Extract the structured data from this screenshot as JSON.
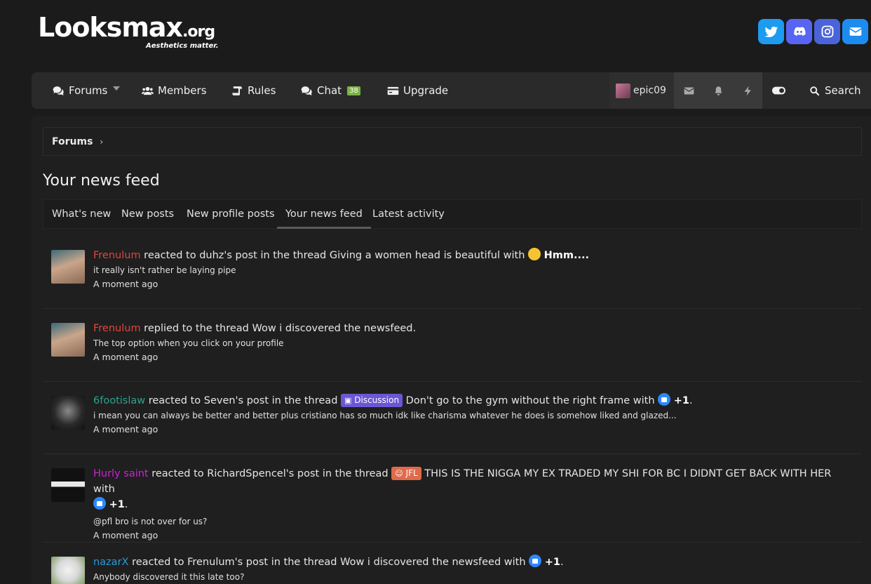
{
  "brand": {
    "name": "Looksmax",
    "tld": ".org",
    "tagline": "Aesthetics matter."
  },
  "social": [
    {
      "name": "twitter",
      "color": "#1d9bf0"
    },
    {
      "name": "discord",
      "color": "#5865f2"
    },
    {
      "name": "instagram",
      "color": "#4a63d8"
    },
    {
      "name": "email",
      "color": "#1d8cf0"
    }
  ],
  "nav": {
    "forums": "Forums",
    "members": "Members",
    "rules": "Rules",
    "chat": "Chat",
    "chat_count": "38",
    "upgrade": "Upgrade",
    "username": "epic09",
    "search": "Search"
  },
  "breadcrumb": {
    "root": "Forums",
    "sep": "›"
  },
  "page_title": "Your news feed",
  "tabs": [
    "What's new",
    "New posts",
    "New profile posts",
    "Your news feed",
    "Latest activity"
  ],
  "colors": {
    "red_user": "#e0463d",
    "green_user": "#2ba38b",
    "magenta_user": "#d020d6",
    "blue_user": "#2b9bd6",
    "discussion": "#6b57d6",
    "jfl": "#e06a4a"
  },
  "feed": [
    {
      "user": "Frenulum",
      "text": " reacted to duhz's post in the thread Giving a women head is beautiful with ",
      "reaction": "Hmm....",
      "reaction_icon": "thinking-emoji",
      "snippet": "it really isn't rather be laying pipe",
      "time": "A moment ago"
    },
    {
      "user": "Frenulum",
      "text": " replied to the thread Wow i discovered the newsfeed.",
      "snippet": "The top option when you click on your profile",
      "time": "A moment ago"
    },
    {
      "user": "6footislaw",
      "text_a": " reacted to Seven's post in the thread ",
      "prefix": "Discussion",
      "text_b": " Don't go to the gym without the right frame with ",
      "reaction": "+1",
      "snippet": "i mean you can always be better and better plus cristiano has so much idk like charisma whatever he does is somehow liked and glazed...",
      "time": "A moment ago"
    },
    {
      "user": "Hurly saint",
      "text_a": " reacted to RichardSpencel's post in the thread ",
      "prefix": "JFL",
      "text_b": " THIS IS THE NIGGA MY EX TRADED MY SHI FOR BC I DIDNT GET BACK WITH HER with",
      "reaction": "+1",
      "snippet": "@pfl bro is not over for us?",
      "time": "A moment ago"
    },
    {
      "user": "nazarX",
      "text": " reacted to Frenulum's post in the thread Wow i discovered the newsfeed with ",
      "reaction": "+1",
      "snippet": "Anybody discovered it this late too?",
      "time": "A moment ago"
    }
  ]
}
